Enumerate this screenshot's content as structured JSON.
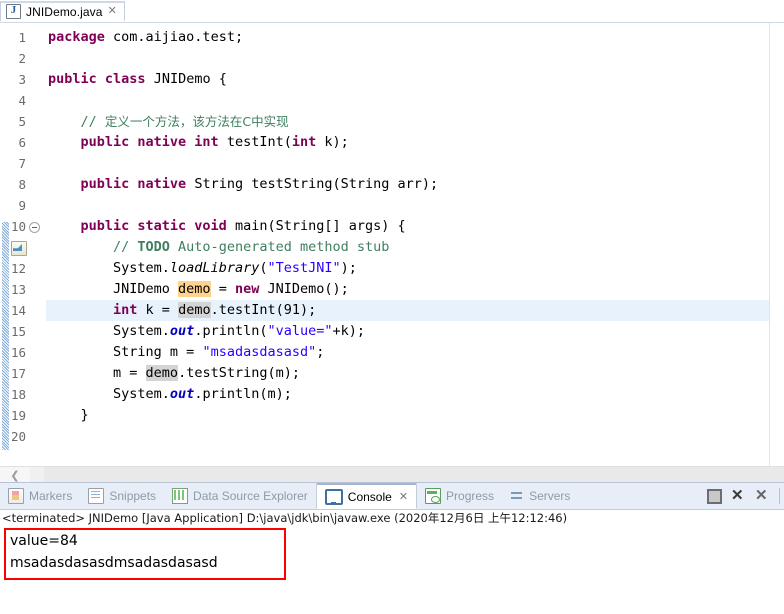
{
  "editor": {
    "tab": {
      "label": "JNIDemo.java",
      "icon": "java-file-icon",
      "close_glyph": "✕"
    },
    "lines": [
      {
        "n": "1",
        "tokens": [
          {
            "t": "package ",
            "c": "kw"
          },
          {
            "t": "com.aijiao.test;",
            "c": "plain"
          }
        ]
      },
      {
        "n": "2",
        "tokens": []
      },
      {
        "n": "3",
        "tokens": [
          {
            "t": "public ",
            "c": "kw"
          },
          {
            "t": "class ",
            "c": "kw"
          },
          {
            "t": "JNIDemo {",
            "c": "plain"
          }
        ]
      },
      {
        "n": "4",
        "tokens": []
      },
      {
        "n": "5",
        "tokens": [
          {
            "t": "    // ",
            "c": "cmt"
          },
          {
            "t": "定义一个方法，该方法在C中实现",
            "c": "cmt-cn"
          }
        ]
      },
      {
        "n": "6",
        "tokens": [
          {
            "t": "    ",
            "c": "plain"
          },
          {
            "t": "public native int ",
            "c": "kw"
          },
          {
            "t": "testInt(",
            "c": "plain"
          },
          {
            "t": "int ",
            "c": "kw"
          },
          {
            "t": "k);",
            "c": "plain"
          }
        ]
      },
      {
        "n": "7",
        "tokens": []
      },
      {
        "n": "8",
        "tokens": [
          {
            "t": "    ",
            "c": "plain"
          },
          {
            "t": "public native ",
            "c": "kw"
          },
          {
            "t": "String testString(String arr);",
            "c": "plain"
          }
        ]
      },
      {
        "n": "9",
        "tokens": []
      },
      {
        "n": "10",
        "fold": true,
        "tokens": [
          {
            "t": "    ",
            "c": "plain"
          },
          {
            "t": "public static void ",
            "c": "kw"
          },
          {
            "t": "main(String[] args) {",
            "c": "plain"
          }
        ]
      },
      {
        "n": "11",
        "todo": true,
        "tokens": [
          {
            "t": "        // ",
            "c": "cmt"
          },
          {
            "t": "TODO",
            "c": "todo"
          },
          {
            "t": " Auto-generated method stub",
            "c": "cmt"
          }
        ]
      },
      {
        "n": "12",
        "tokens": [
          {
            "t": "        System.",
            "c": "plain"
          },
          {
            "t": "loadLibrary",
            "c": "plain stat"
          },
          {
            "t": "(",
            "c": "plain"
          },
          {
            "t": "\"TestJNI\"",
            "c": "str"
          },
          {
            "t": ");",
            "c": "plain"
          }
        ]
      },
      {
        "n": "13",
        "tokens": [
          {
            "t": "        JNIDemo ",
            "c": "plain"
          },
          {
            "t": "demo",
            "c": "plain hl-decl"
          },
          {
            "t": " = ",
            "c": "plain"
          },
          {
            "t": "new ",
            "c": "kw"
          },
          {
            "t": "JNIDemo();",
            "c": "plain"
          }
        ]
      },
      {
        "n": "14",
        "current": true,
        "tokens": [
          {
            "t": "        ",
            "c": "plain"
          },
          {
            "t": "int ",
            "c": "kw"
          },
          {
            "t": "k = ",
            "c": "plain"
          },
          {
            "t": "demo",
            "c": "plain hl-occ"
          },
          {
            "t": ".testInt(91);",
            "c": "plain"
          }
        ]
      },
      {
        "n": "15",
        "tokens": [
          {
            "t": "        System.",
            "c": "plain"
          },
          {
            "t": "out",
            "c": "field"
          },
          {
            "t": ".println(",
            "c": "plain"
          },
          {
            "t": "\"value=\"",
            "c": "str"
          },
          {
            "t": "+k);",
            "c": "plain"
          }
        ]
      },
      {
        "n": "16",
        "tokens": [
          {
            "t": "        String m = ",
            "c": "plain"
          },
          {
            "t": "\"msadasdasasd\"",
            "c": "str"
          },
          {
            "t": ";",
            "c": "plain"
          }
        ]
      },
      {
        "n": "17",
        "tokens": [
          {
            "t": "        m = ",
            "c": "plain"
          },
          {
            "t": "demo",
            "c": "plain hl-occ"
          },
          {
            "t": ".testString(m);",
            "c": "plain"
          }
        ]
      },
      {
        "n": "18",
        "tokens": [
          {
            "t": "        System.",
            "c": "plain"
          },
          {
            "t": "out",
            "c": "field"
          },
          {
            "t": ".println(m);",
            "c": "plain"
          }
        ]
      },
      {
        "n": "19",
        "tokens": [
          {
            "t": "    }",
            "c": "plain"
          }
        ]
      },
      {
        "n": "20",
        "tokens": []
      }
    ],
    "hscroll_left_glyph": "❮"
  },
  "bottom_panel": {
    "tabs": [
      {
        "label": "Markers",
        "icon": "markers-icon",
        "active": false
      },
      {
        "label": "Snippets",
        "icon": "snippets-icon",
        "active": false
      },
      {
        "label": "Data Source Explorer",
        "icon": "data-source-explorer-icon",
        "active": false
      },
      {
        "label": "Console",
        "icon": "console-icon",
        "active": true,
        "close_glyph": "✕"
      },
      {
        "label": "Progress",
        "icon": "progress-icon",
        "active": false
      },
      {
        "label": "Servers",
        "icon": "servers-icon",
        "active": false
      }
    ],
    "toolbar": {
      "stop_label": "Terminate",
      "remove_label": "✕",
      "remove_all_label": "✕"
    },
    "console": {
      "header": "<terminated> JNIDemo [Java Application] D:\\java\\jdk\\bin\\javaw.exe (2020年12月6日 上午12:12:46)",
      "output": [
        "value=84",
        "msadasdasasdmsadasdasasd"
      ],
      "highlight_color": "#ff0000"
    }
  }
}
